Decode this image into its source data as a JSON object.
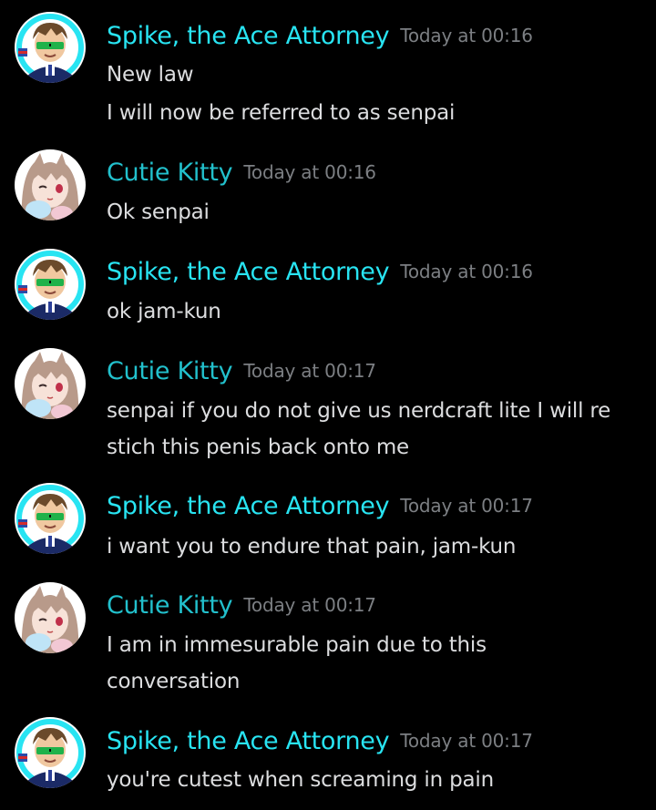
{
  "users": {
    "spike": {
      "name": "Spike, the Ace Attorney",
      "color": "#28e4f2",
      "avatar": "spike-avatar"
    },
    "kitty": {
      "name": "Cutie Kitty",
      "color": "#22c0cc",
      "avatar": "kitty-avatar"
    }
  },
  "messages": [
    {
      "author": "Spike, the Ace Attorney",
      "time": "Today at 00:16",
      "lines": [
        "New law",
        "I will now be referred to as senpai"
      ]
    },
    {
      "author": "Cutie Kitty",
      "time": "Today at 00:16",
      "lines": [
        "Ok senpai"
      ]
    },
    {
      "author": "Spike, the Ace Attorney",
      "time": "Today at 00:16",
      "lines": [
        "ok jam-kun"
      ]
    },
    {
      "author": "Cutie Kitty",
      "time": "Today at 00:17",
      "lines": [
        "senpai if you do not give us nerdcraft lite I will re",
        "stich this penis back onto me"
      ]
    },
    {
      "author": "Spike, the Ace Attorney",
      "time": "Today at 00:17",
      "lines": [
        "i want you to endure that pain, jam-kun"
      ]
    },
    {
      "author": "Cutie Kitty",
      "time": "Today at 00:17",
      "lines": [
        "I am in immesurable pain due to this",
        "conversation"
      ]
    },
    {
      "author": "Spike, the Ace Attorney",
      "time": "Today at 00:17",
      "lines": [
        "you're cutest when screaming in pain"
      ]
    }
  ]
}
